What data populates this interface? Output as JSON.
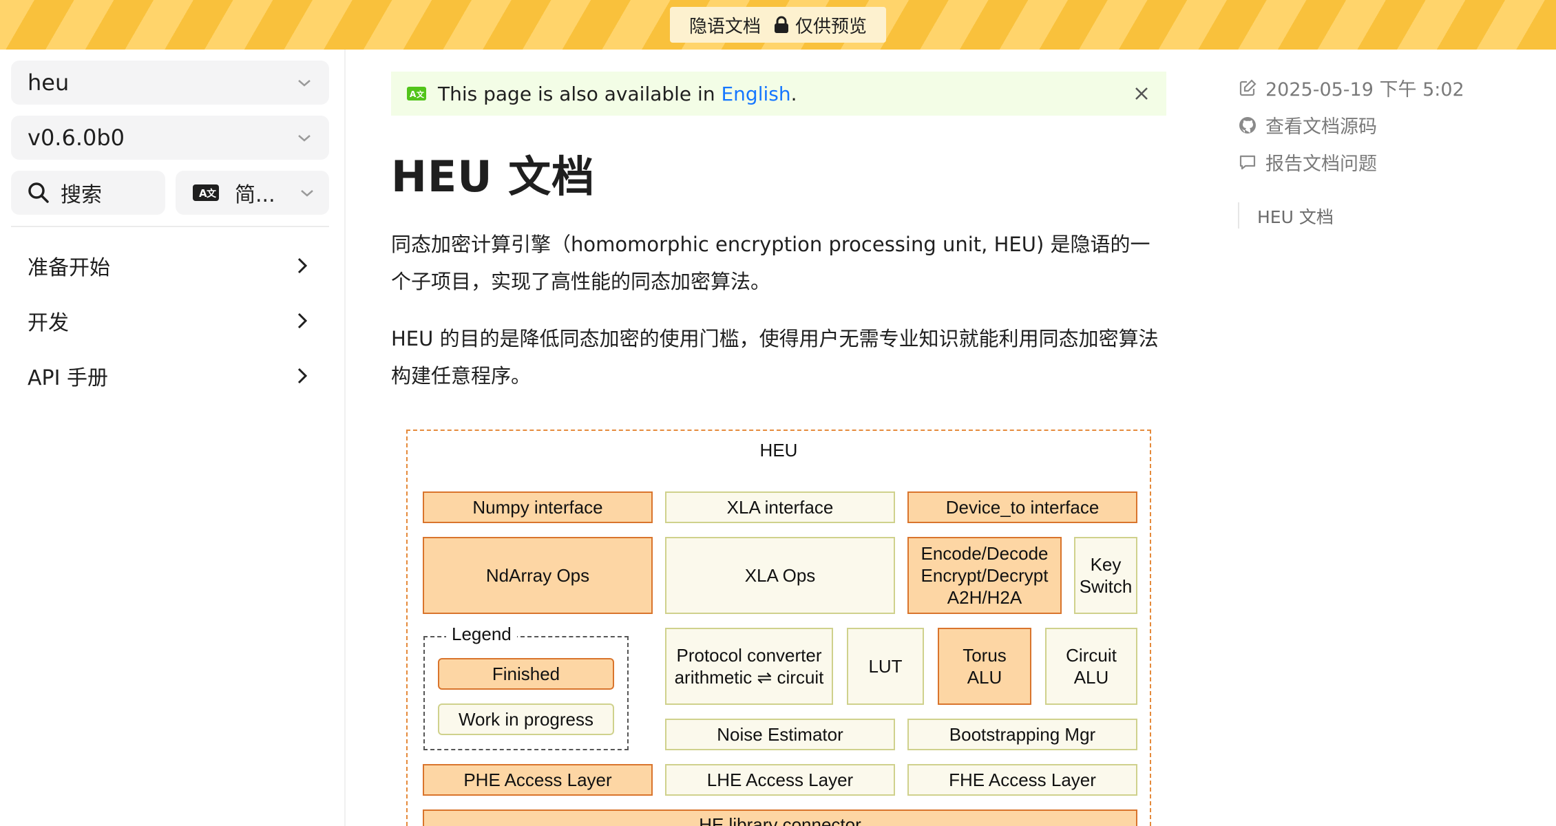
{
  "banner": {
    "site": "隐语文档",
    "preview": "仅供预览"
  },
  "sidebar": {
    "project": "heu",
    "version": "v0.6.0b0",
    "search_label": "搜索",
    "language": "简...",
    "items": [
      {
        "label": "准备开始"
      },
      {
        "label": "开发"
      },
      {
        "label": "API 手册"
      }
    ]
  },
  "notice": {
    "prefix": "This page is also available in ",
    "link": "English",
    "suffix": "."
  },
  "page": {
    "title": "HEU 文档",
    "paragraphs": [
      "同态加密计算引擎（homomorphic encryption processing unit, HEU) 是隐语的一个子项目，实现了高性能的同态加密算法。",
      "HEU 的目的是降低同态加密的使用门槛，使得用户无需专业知识就能利用同态加密算法构建任意程序。"
    ]
  },
  "diagram": {
    "title": "HEU",
    "numpy_interface": "Numpy interface",
    "xla_interface": "XLA interface",
    "device_to_interface": "Device_to interface",
    "ndarray_ops": "NdArray Ops",
    "xla_ops": "XLA Ops",
    "encode_decode": "Encode/Decode\nEncrypt/Decrypt\nA2H/H2A",
    "key_switch": "Key\nSwitch",
    "legend_title": "Legend",
    "legend_finished": "Finished",
    "legend_wip": "Work in progress",
    "protocol_converter": "Protocol converter\narithmetic ⇌ circuit",
    "lut": "LUT",
    "torus_alu": "Torus\nALU",
    "circuit_alu": "Circuit\nALU",
    "noise_estimator": "Noise Estimator",
    "bootstrapping_mgr": "Bootstrapping Mgr",
    "phe_access": "PHE Access Layer",
    "lhe_access": "LHE Access Layer",
    "fhe_access": "FHE Access Layer",
    "he_connector": "HE library connector",
    "colors": {
      "finished": "#fdd6a4",
      "finished_border": "#d9742c",
      "wip": "#fbf9ec",
      "wip_border": "#cfd18c",
      "frame": "#e58a3b"
    }
  },
  "rail": {
    "updated": "2025-05-19 下午 5:02",
    "view_source": "查看文档源码",
    "report_issue": "报告文档问题",
    "toc": [
      "HEU 文档"
    ]
  },
  "icons": {
    "lock": "lock-icon",
    "chevron": "chevron-down-icon",
    "search": "search-icon",
    "translate": "translate-icon",
    "arrow": "chevron-right-icon",
    "close": "close-icon",
    "edit": "edit-icon",
    "github": "github-icon",
    "comment": "comment-icon"
  }
}
